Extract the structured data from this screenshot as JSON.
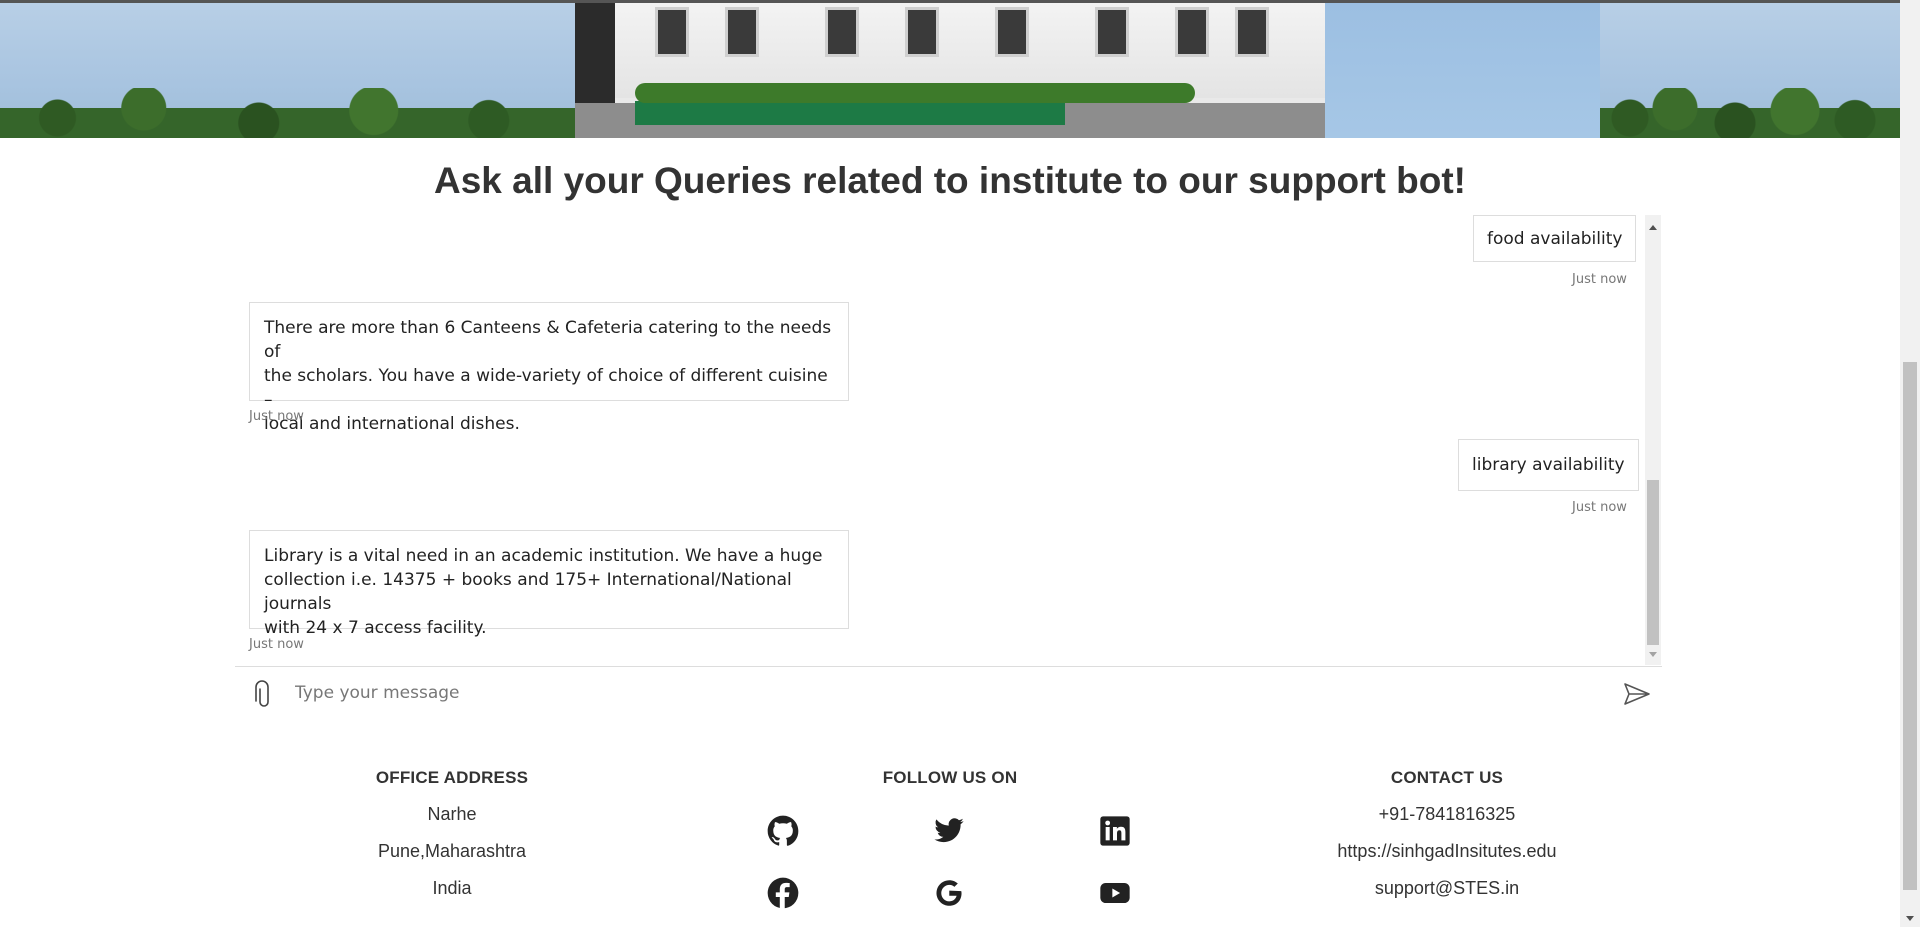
{
  "headline": "Ask all your Queries related to institute to our support bot!",
  "chat": {
    "messages": [
      {
        "sender": "user",
        "text": "food availability",
        "time": "Just now"
      },
      {
        "sender": "bot",
        "lines": [
          "There are more than 6 Canteens & Cafeteria catering to the needs of",
          "the scholars. You have a wide-variety of choice of different cuisine –",
          "local and international dishes."
        ],
        "time": "Just now"
      },
      {
        "sender": "user",
        "text": "library availability",
        "time": "Just now"
      },
      {
        "sender": "bot",
        "lines": [
          "Library is a vital need in an academic institution. We have a huge",
          "collection i.e. 14375 + books and 175+ International/National journals",
          "with 24 x 7 access facility."
        ],
        "time": "Just now"
      }
    ],
    "input_placeholder": "Type your message"
  },
  "footer": {
    "office": {
      "heading": "OFFICE ADDRESS",
      "lines": [
        "Narhe",
        "Pune,Maharashtra",
        "India"
      ]
    },
    "follow": {
      "heading": "FOLLOW US ON",
      "icons": [
        "github-icon",
        "twitter-icon",
        "linkedin-icon",
        "facebook-icon",
        "google-icon",
        "youtube-icon"
      ]
    },
    "contact": {
      "heading": "CONTACT US",
      "phone": "+91-7841816325",
      "website": "https://sinhgadInsitutes.edu",
      "email": "support@STES.in"
    }
  },
  "colors": {
    "text": "#333333",
    "border": "#dddddd",
    "timestamp": "#777777"
  }
}
